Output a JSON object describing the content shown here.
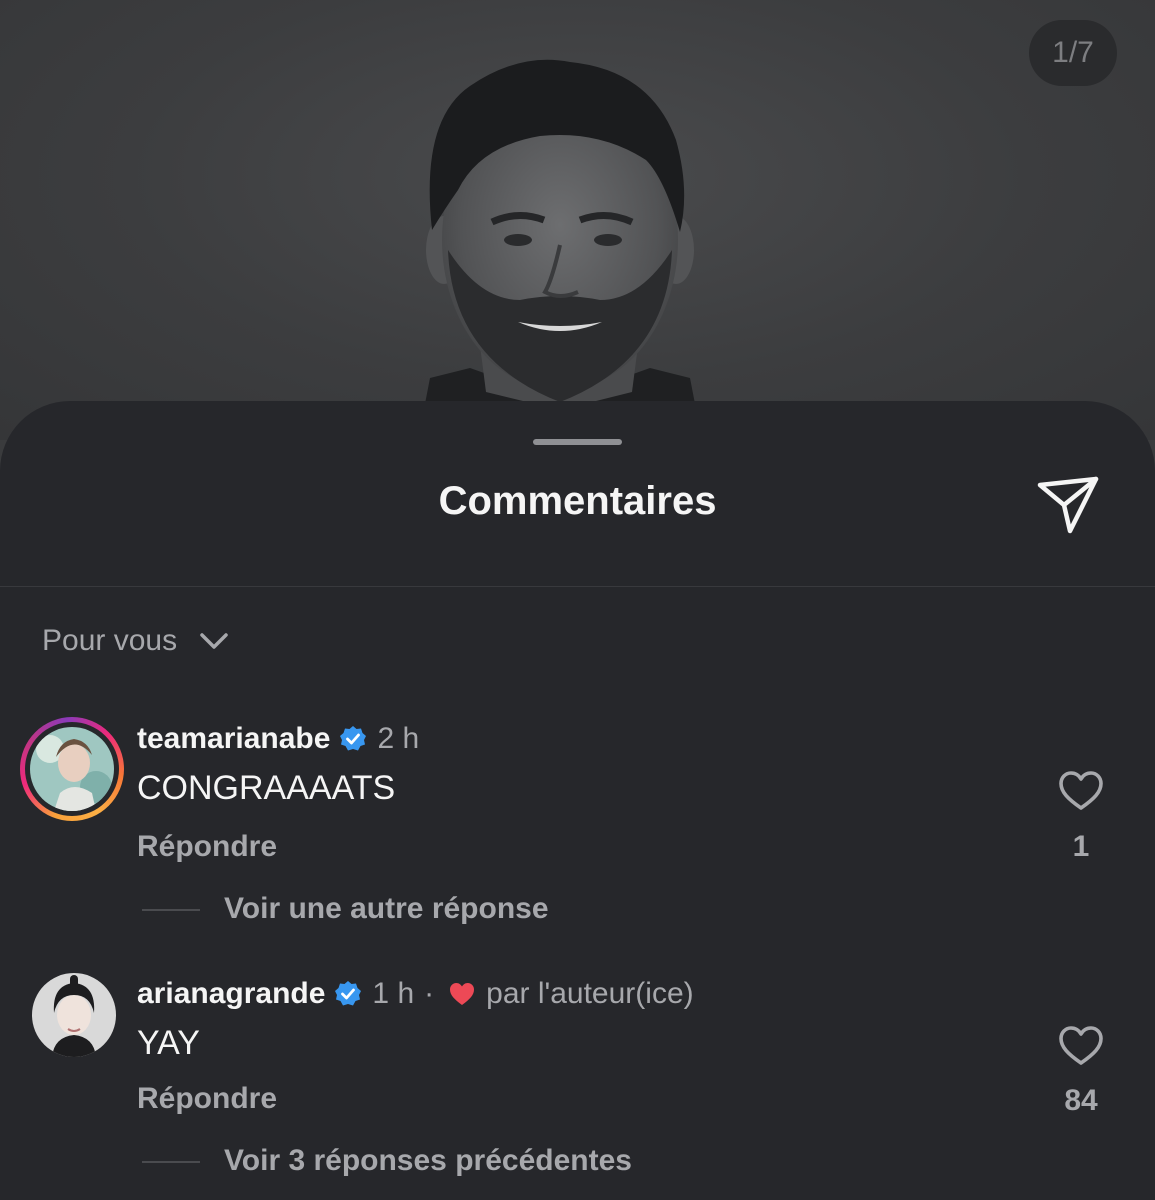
{
  "post": {
    "image_counter": "1/7"
  },
  "sheet": {
    "title": "Commentaires",
    "share_icon": "paper-plane-icon",
    "sort_label": "Pour vous",
    "sort_icon": "chevron-down-icon"
  },
  "comments": [
    {
      "username": "teamarianabe",
      "verified": true,
      "time": "2 h",
      "text": "CONGRAAAATS",
      "reply_label": "Répondre",
      "likes": "1",
      "replies_link": "Voir une autre réponse",
      "story_ring": true
    },
    {
      "username": "arianagrande",
      "verified": true,
      "time": "1 h",
      "separator": "·",
      "liked_by_author": "par l'auteur(ice)",
      "text": "YAY",
      "reply_label": "Répondre",
      "likes": "84",
      "replies_link": "Voir 3 réponses précédentes",
      "story_ring": false
    }
  ],
  "colors": {
    "verified_badge": "#3897f0",
    "author_heart": "#ed4956",
    "sheet_background": "#26272b"
  }
}
